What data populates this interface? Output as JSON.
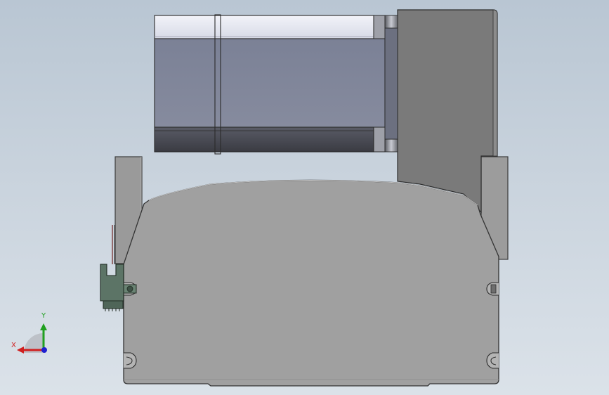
{
  "triad": {
    "x_label": "X",
    "y_label": "Y",
    "x_color": "#d02020",
    "y_color": "#20a020",
    "z_color": "#2020d0"
  },
  "colors": {
    "background_top": "#b9c6d3",
    "background_bottom": "#dbe2e9",
    "base_body": "#a0a0a0",
    "gearbox": "#7a7a7a",
    "motor_body": "#80869a",
    "motor_top_highlight": "#e6e8f2",
    "motor_bottom_shadow": "#45464f",
    "sensor_bracket": "#5c7466"
  }
}
